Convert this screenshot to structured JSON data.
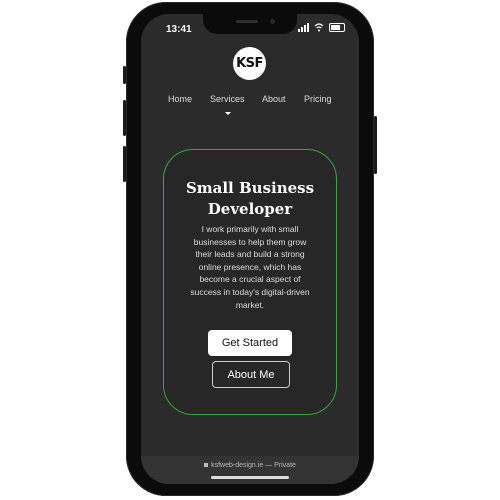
{
  "status_bar": {
    "time": "13:41"
  },
  "logo": {
    "text": "KSF"
  },
  "nav": {
    "items": [
      "Home",
      "Services",
      "About",
      "Pricing"
    ]
  },
  "hero": {
    "title_line1": "Small Business",
    "title_line2": "Developer",
    "body": "I work primarily with small businesses to help them grow their leads and build a strong online presence, which has become a crucial aspect of success in today's digital-driven market."
  },
  "buttons": {
    "primary": "Get Started",
    "secondary": "About Me"
  },
  "browser": {
    "url": "ksfweb-design.ie",
    "mode": "— Private"
  },
  "colors": {
    "accent": "#3aa33a",
    "background": "#2b2b2b"
  }
}
